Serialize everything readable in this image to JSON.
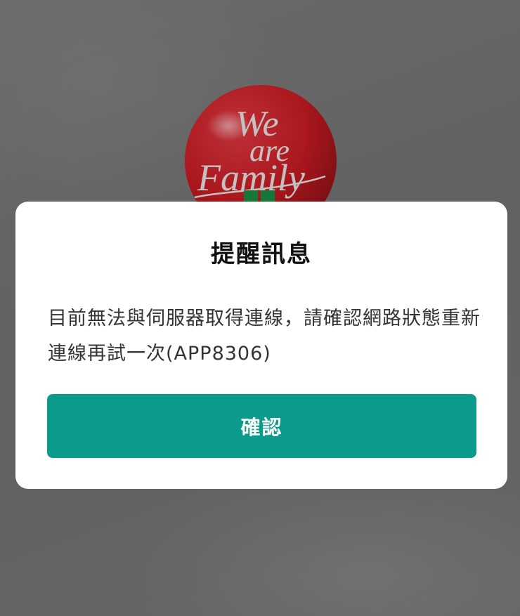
{
  "background": {
    "logo": {
      "icon": "we-are-family-logo-icon",
      "text": "We are Family",
      "color": "#c8141c"
    }
  },
  "dialog": {
    "title": "提醒訊息",
    "message": "目前無法與伺服器取得連線，請確認網路狀態重新連線再試一次(APP8306)",
    "confirm_label": "確認",
    "accent_color": "#0a9b8d"
  }
}
